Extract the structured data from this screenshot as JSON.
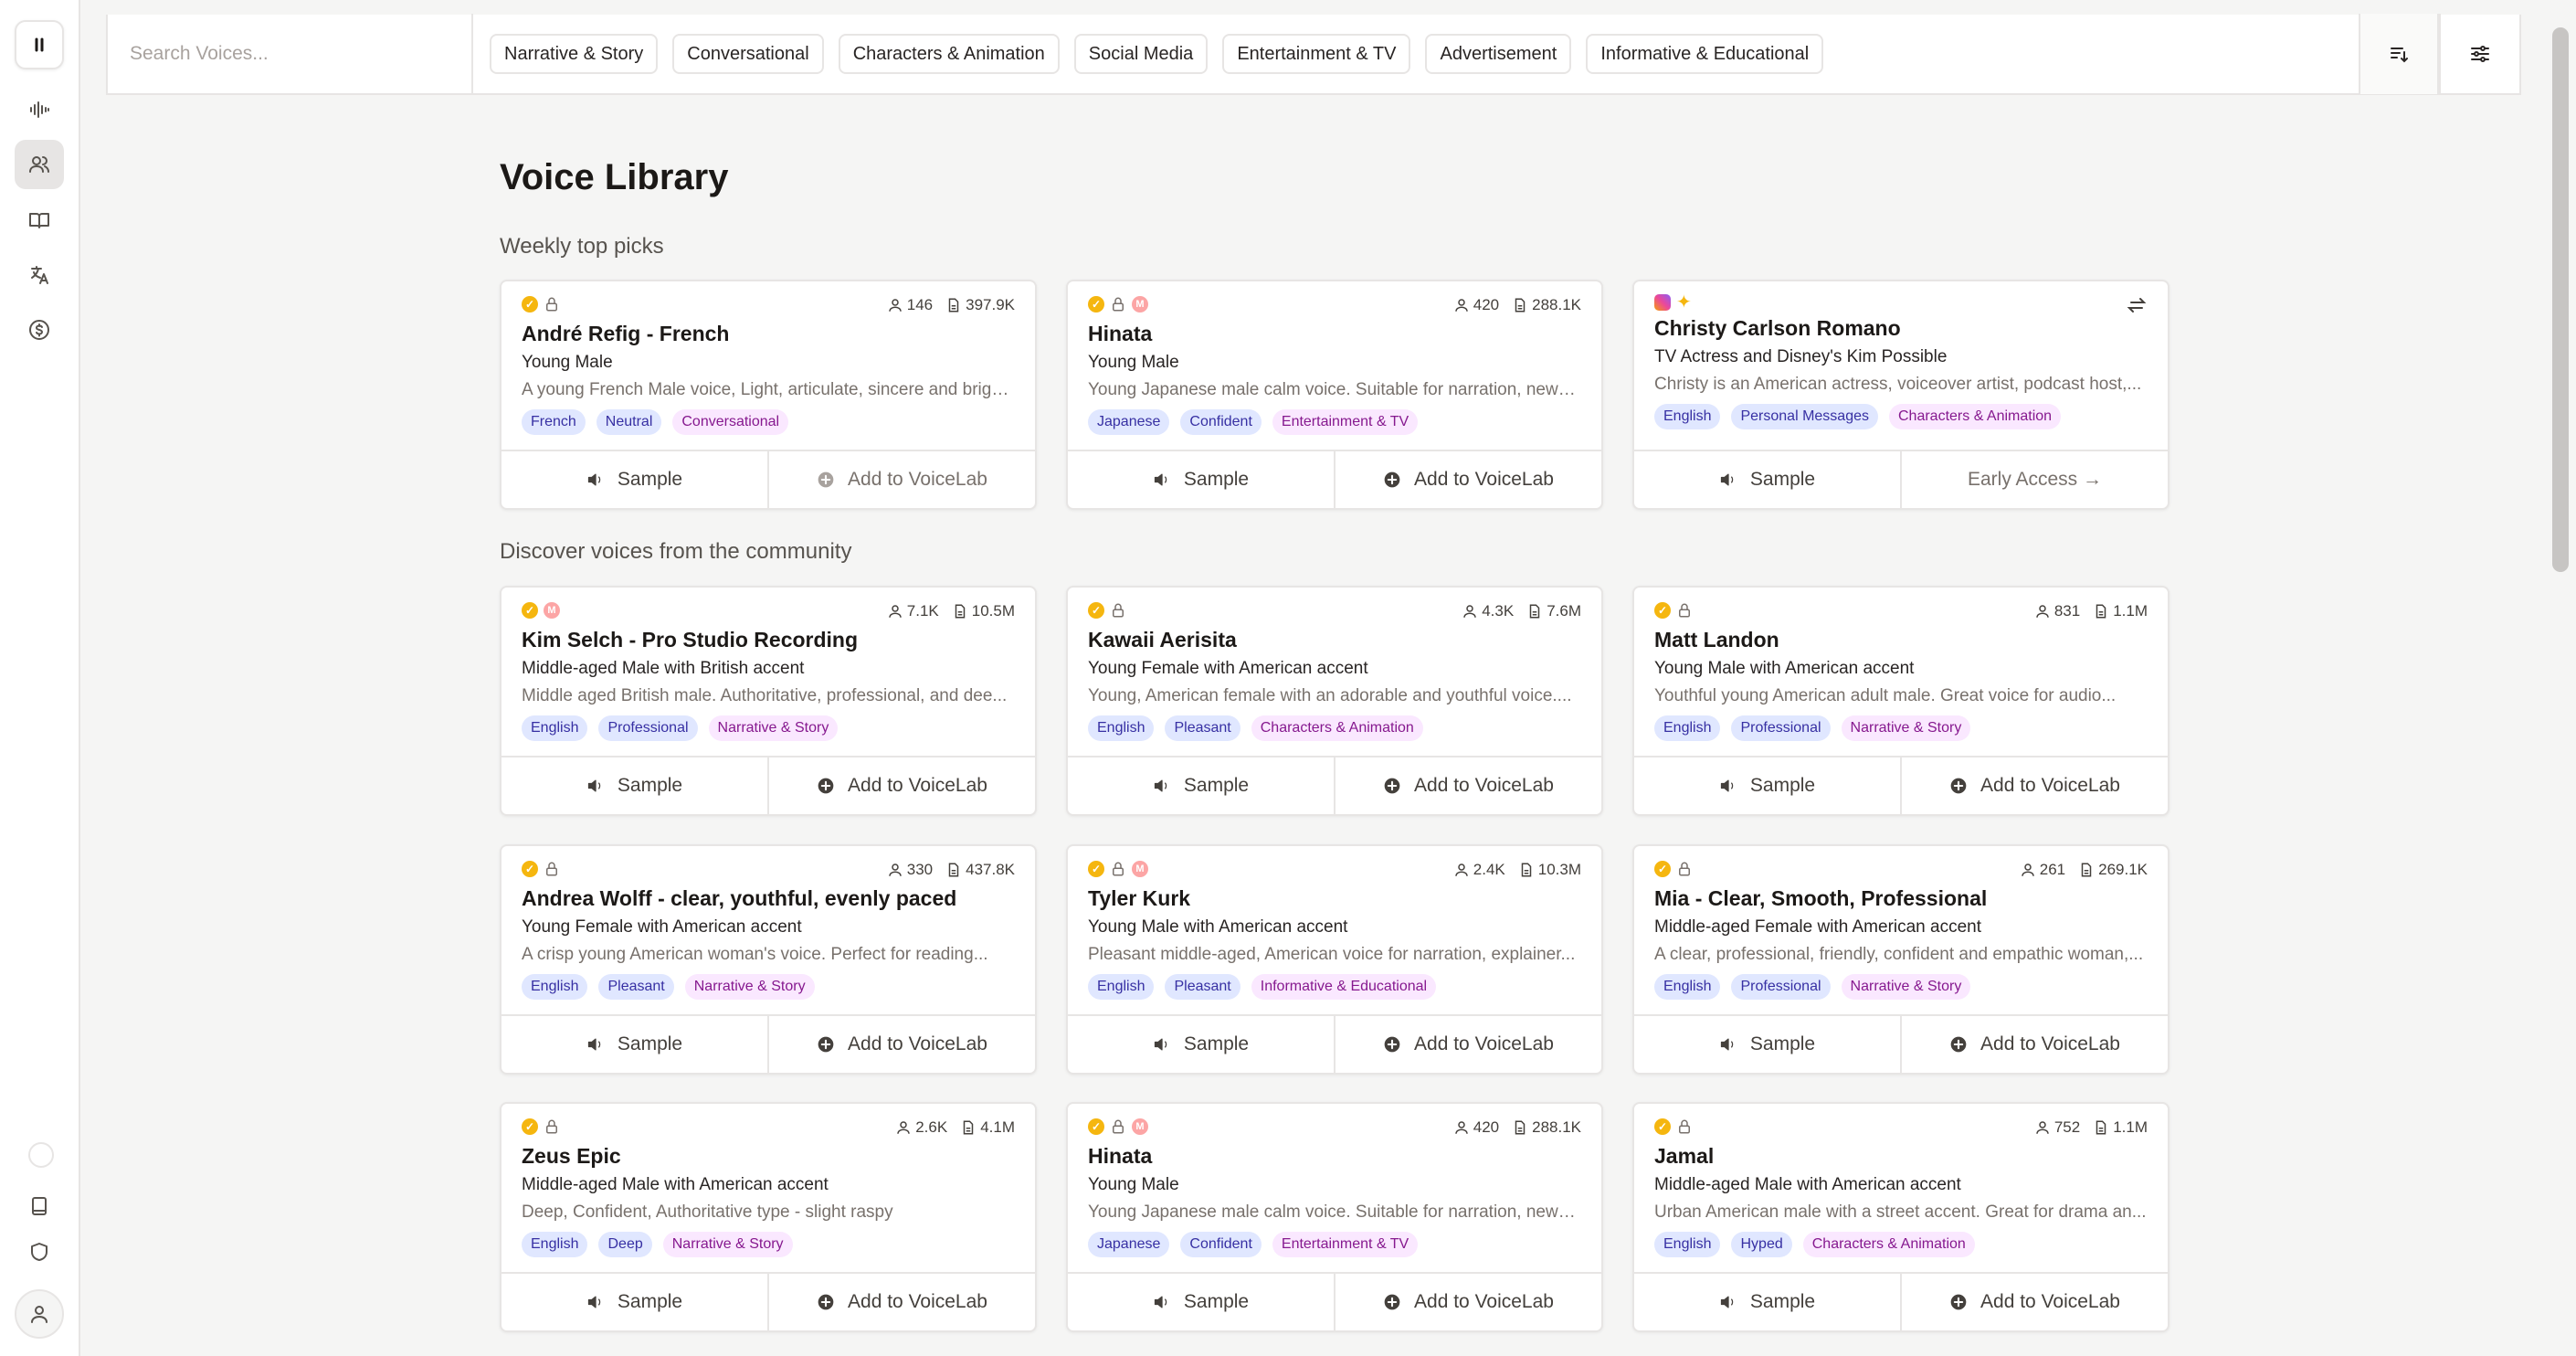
{
  "search": {
    "placeholder": "Search Voices..."
  },
  "categories": [
    "Narrative & Story",
    "Conversational",
    "Characters & Animation",
    "Social Media",
    "Entertainment & TV",
    "Advertisement",
    "Informative & Educational"
  ],
  "page_title": "Voice Library",
  "sections": {
    "weekly": "Weekly top picks",
    "community": "Discover voices from the community"
  },
  "cards": [
    {
      "name": "André Refig - French",
      "sub": "Young Male",
      "desc": "A young French Male voice, Light, articulate, sincere and brigh...",
      "users": "146",
      "chars": "397.9K",
      "tags": [
        "French",
        "Neutral",
        "Conversational"
      ],
      "action1": "Sample",
      "action2": "Add to VoiceLab"
    },
    {
      "name": "Hinata",
      "sub": "Young Male",
      "desc": "Young Japanese male calm voice. Suitable for narration, news,...",
      "users": "420",
      "chars": "288.1K",
      "tags": [
        "Japanese",
        "Confident",
        "Entertainment & TV"
      ],
      "action1": "Sample",
      "action2": "Add to VoiceLab"
    },
    {
      "name": "Christy Carlson Romano",
      "sub": "TV Actress and Disney's Kim Possible",
      "desc": "Christy is an American actress, voiceover artist, podcast host,...",
      "tags": [
        "English",
        "Personal Messages",
        "Characters & Animation"
      ],
      "action1": "Sample",
      "action2": "Early Access →"
    },
    {
      "name": "Kim Selch - Pro Studio Recording",
      "sub": "Middle-aged Male with British accent",
      "desc": "Middle aged British male. Authoritative, professional, and dee...",
      "users": "7.1K",
      "chars": "10.5M",
      "tags": [
        "English",
        "Professional",
        "Narrative & Story"
      ],
      "action1": "Sample",
      "action2": "Add to VoiceLab"
    },
    {
      "name": "Kawaii Aerisita",
      "sub": "Young Female with American accent",
      "desc": "Young, American female with an adorable and youthful voice....",
      "users": "4.3K",
      "chars": "7.6M",
      "tags": [
        "English",
        "Pleasant",
        "Characters & Animation"
      ],
      "action1": "Sample",
      "action2": "Add to VoiceLab"
    },
    {
      "name": "Matt Landon",
      "sub": "Young Male with American accent",
      "desc": "Youthful young American adult male. Great voice for audio...",
      "users": "831",
      "chars": "1.1M",
      "tags": [
        "English",
        "Professional",
        "Narrative & Story"
      ],
      "action1": "Sample",
      "action2": "Add to VoiceLab"
    },
    {
      "name": "Andrea Wolff - clear, youthful, evenly paced",
      "sub": "Young Female with American accent",
      "desc": "A crisp young American woman's voice. Perfect for reading...",
      "users": "330",
      "chars": "437.8K",
      "tags": [
        "English",
        "Pleasant",
        "Narrative & Story"
      ],
      "action1": "Sample",
      "action2": "Add to VoiceLab"
    },
    {
      "name": "Tyler Kurk",
      "sub": "Young Male with American accent",
      "desc": "Pleasant middle-aged, American voice for narration, explainer...",
      "users": "2.4K",
      "chars": "10.3M",
      "tags": [
        "English",
        "Pleasant",
        "Informative & Educational"
      ],
      "action1": "Sample",
      "action2": "Add to VoiceLab"
    },
    {
      "name": "Mia - Clear, Smooth, Professional",
      "sub": "Middle-aged Female with American accent",
      "desc": "A clear, professional, friendly, confident and empathic woman,...",
      "users": "261",
      "chars": "269.1K",
      "tags": [
        "English",
        "Professional",
        "Narrative & Story"
      ],
      "action1": "Sample",
      "action2": "Add to VoiceLab"
    },
    {
      "name": "Zeus Epic",
      "sub": "Middle-aged Male with American accent",
      "desc": "Deep, Confident, Authoritative type - slight raspy",
      "users": "2.6K",
      "chars": "4.1M",
      "tags": [
        "English",
        "Deep",
        "Narrative & Story"
      ],
      "action1": "Sample",
      "action2": "Add to VoiceLab"
    },
    {
      "name": "Hinata",
      "sub": "Young Male",
      "desc": "Young Japanese male calm voice. Suitable for narration, news,...",
      "users": "420",
      "chars": "288.1K",
      "tags": [
        "Japanese",
        "Confident",
        "Entertainment & TV"
      ],
      "action1": "Sample",
      "action2": "Add to VoiceLab"
    },
    {
      "name": "Jamal",
      "sub": "Middle-aged Male with American accent",
      "desc": "Urban American male with a street accent. Great for drama an...",
      "users": "752",
      "chars": "1.1M",
      "tags": [
        "English",
        "Hyped",
        "Characters & Animation"
      ],
      "action1": "Sample",
      "action2": "Add to VoiceLab"
    }
  ],
  "colors": {
    "verified": "#f5b60f",
    "tag_blue_bg": "#e0e7ff",
    "tag_pink_bg": "#fae8ff"
  }
}
